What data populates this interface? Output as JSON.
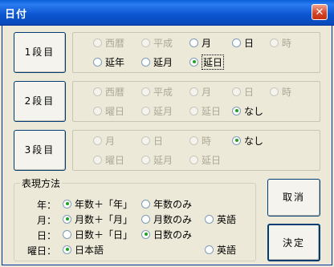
{
  "window": {
    "title": "日付",
    "close_glyph": "✕"
  },
  "rows": [
    {
      "button": "1段目",
      "options": [
        {
          "label": "西暦",
          "disabled": true,
          "selected": false
        },
        {
          "label": "平成",
          "disabled": true,
          "selected": false
        },
        {
          "label": "月",
          "disabled": false,
          "selected": false
        },
        {
          "label": "日",
          "disabled": false,
          "selected": false
        },
        {
          "label": "時",
          "disabled": true,
          "selected": false
        },
        {
          "label": "延年",
          "disabled": false,
          "selected": false
        },
        {
          "label": "延月",
          "disabled": false,
          "selected": false
        },
        {
          "label": "延日",
          "disabled": false,
          "selected": true
        }
      ]
    },
    {
      "button": "2段目",
      "options": [
        {
          "label": "西暦",
          "disabled": true,
          "selected": false
        },
        {
          "label": "平成",
          "disabled": true,
          "selected": false
        },
        {
          "label": "月",
          "disabled": true,
          "selected": false
        },
        {
          "label": "日",
          "disabled": true,
          "selected": false
        },
        {
          "label": "時",
          "disabled": true,
          "selected": false
        },
        {
          "label": "曜日",
          "disabled": true,
          "selected": false
        },
        {
          "label": "延月",
          "disabled": true,
          "selected": false
        },
        {
          "label": "延日",
          "disabled": true,
          "selected": false
        },
        {
          "label": "なし",
          "disabled": false,
          "selected": true
        }
      ]
    },
    {
      "button": "3段目",
      "options": [
        {
          "label": "月",
          "disabled": true,
          "selected": false
        },
        {
          "label": "日",
          "disabled": true,
          "selected": false
        },
        {
          "label": "時",
          "disabled": true,
          "selected": false
        },
        {
          "label": "なし",
          "disabled": false,
          "selected": true
        },
        {
          "label": "曜日",
          "disabled": true,
          "selected": false
        },
        {
          "label": "延月",
          "disabled": true,
          "selected": false
        },
        {
          "label": "延日",
          "disabled": true,
          "selected": false
        }
      ]
    }
  ],
  "format": {
    "legend": "表現方法",
    "year": {
      "label": "年：",
      "options": [
        {
          "label": "年数＋「年」",
          "selected": true
        },
        {
          "label": "年数のみ",
          "selected": false
        }
      ]
    },
    "month": {
      "label": "月：",
      "options": [
        {
          "label": "月数＋「月」",
          "selected": true
        },
        {
          "label": "月数のみ",
          "selected": false
        },
        {
          "label": "英語",
          "selected": false
        }
      ]
    },
    "day": {
      "label": "日：",
      "options": [
        {
          "label": "日数＋「日」",
          "selected": false
        },
        {
          "label": "日数のみ",
          "selected": true
        }
      ]
    },
    "weekday": {
      "label": "曜日：",
      "options": [
        {
          "label": "日本語",
          "selected": true
        },
        {
          "label": "英語",
          "selected": false
        }
      ]
    }
  },
  "actions": {
    "cancel": "取消",
    "ok": "決定"
  }
}
